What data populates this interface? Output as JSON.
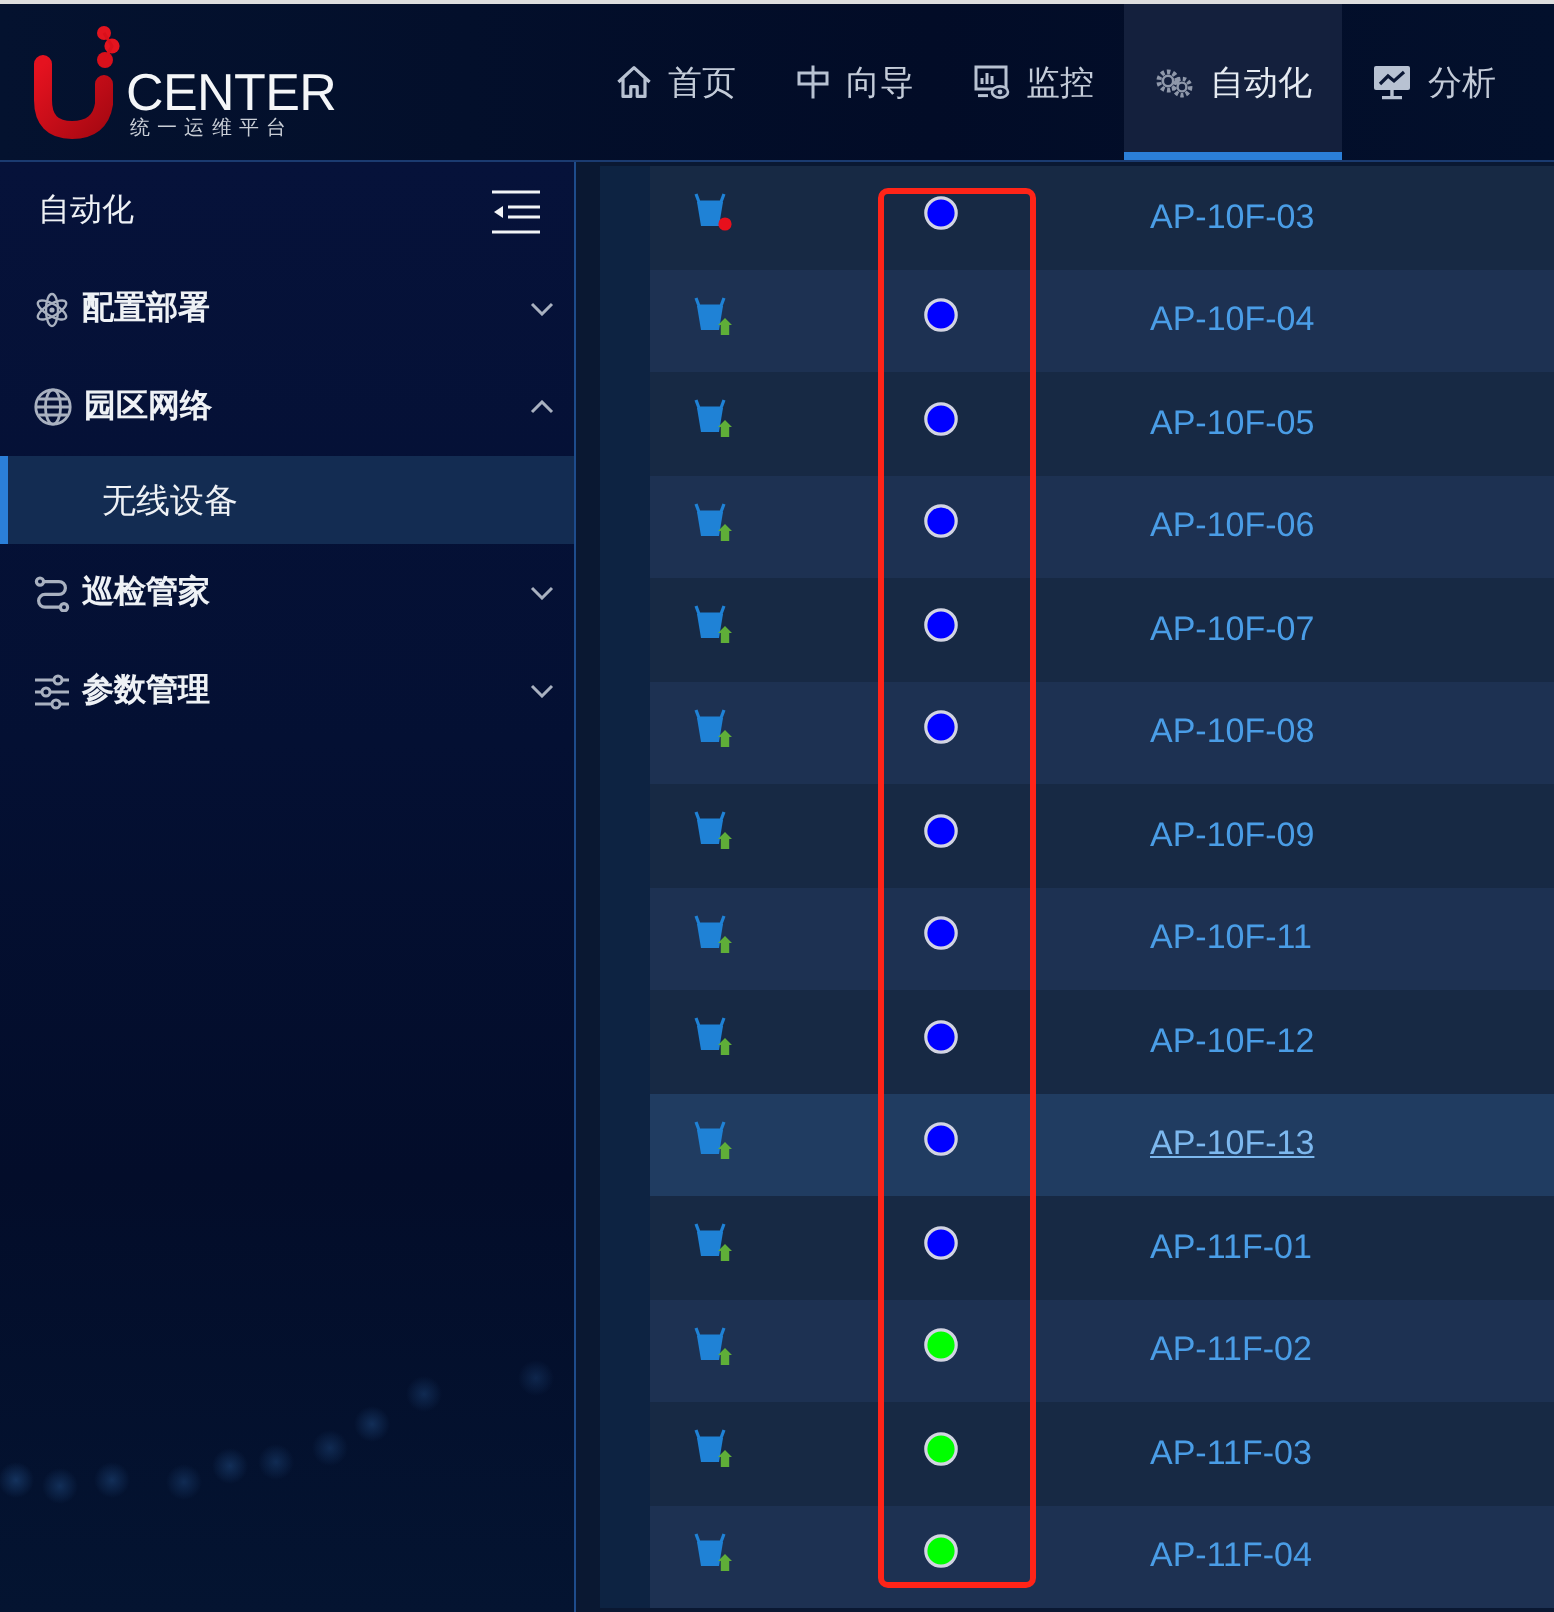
{
  "header": {
    "logo": {
      "title": "CENTER",
      "subtitle": "统一运维平台"
    },
    "tabs": [
      {
        "label": "首页",
        "selected": false
      },
      {
        "label": "向导",
        "selected": false
      },
      {
        "label": "监控",
        "selected": false
      },
      {
        "label": "自动化",
        "selected": true
      },
      {
        "label": "分析",
        "selected": false
      }
    ]
  },
  "sidebar": {
    "title": "自动化",
    "items": [
      {
        "label": "配置部署",
        "expanded": false
      },
      {
        "label": "园区网络",
        "expanded": true,
        "children": [
          {
            "label": "无线设备",
            "selected": true
          }
        ]
      },
      {
        "label": "巡检管家",
        "expanded": false
      },
      {
        "label": "参数管理",
        "expanded": false
      }
    ]
  },
  "table": {
    "status_column_framed": true,
    "rows": [
      {
        "alarm": true,
        "color": "#0000ff",
        "name": "AP-10F-03",
        "highlighted": false
      },
      {
        "alarm": false,
        "color": "#0000ff",
        "name": "AP-10F-04",
        "highlighted": false
      },
      {
        "alarm": false,
        "color": "#0000ff",
        "name": "AP-10F-05",
        "highlighted": false
      },
      {
        "alarm": false,
        "color": "#0000ff",
        "name": "AP-10F-06",
        "highlighted": false
      },
      {
        "alarm": false,
        "color": "#0000ff",
        "name": "AP-10F-07",
        "highlighted": false
      },
      {
        "alarm": false,
        "color": "#0000ff",
        "name": "AP-10F-08",
        "highlighted": false
      },
      {
        "alarm": false,
        "color": "#0000ff",
        "name": "AP-10F-09",
        "highlighted": false
      },
      {
        "alarm": false,
        "color": "#0000ff",
        "name": "AP-10F-11",
        "highlighted": false
      },
      {
        "alarm": false,
        "color": "#0000ff",
        "name": "AP-10F-12",
        "highlighted": false
      },
      {
        "alarm": false,
        "color": "#0000ff",
        "name": "AP-10F-13",
        "highlighted": true
      },
      {
        "alarm": false,
        "color": "#0000ff",
        "name": "AP-11F-01",
        "highlighted": false
      },
      {
        "alarm": false,
        "color": "#00ff00",
        "name": "AP-11F-02",
        "highlighted": false
      },
      {
        "alarm": false,
        "color": "#00ff00",
        "name": "AP-11F-03",
        "highlighted": false
      },
      {
        "alarm": false,
        "color": "#00ff00",
        "name": "AP-11F-04",
        "highlighted": false
      }
    ]
  }
}
